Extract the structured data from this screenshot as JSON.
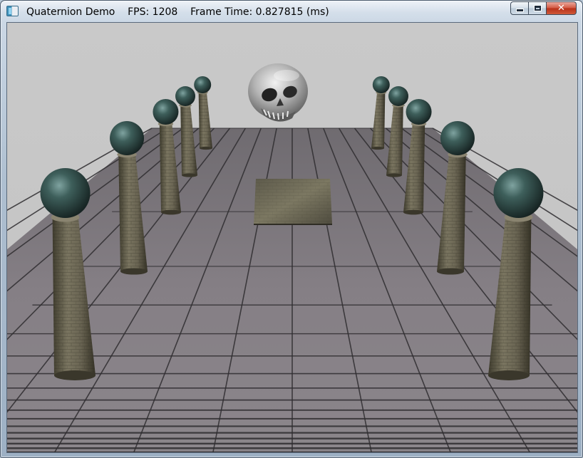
{
  "window": {
    "title": "Quaternion Demo    FPS: 1208    Frame Time: 0.827815 (ms)",
    "icon": "app-window-icon",
    "buttons": {
      "minimize": "minimize-icon",
      "maximize": "maximize-icon",
      "close": "close-icon"
    }
  },
  "colors": {
    "sky": "#c8c8c8",
    "floor": "#7f7a80",
    "grout": "#2f2d30",
    "pillar_stone": "#5f5b48",
    "orb": "#2f4a47",
    "skull": "#b8b8b8",
    "crate": "#6a6652"
  },
  "scene": {
    "objects": [
      "floating-skull",
      "tiled-floor",
      "stone-block",
      "pillar-with-orb x10"
    ]
  }
}
